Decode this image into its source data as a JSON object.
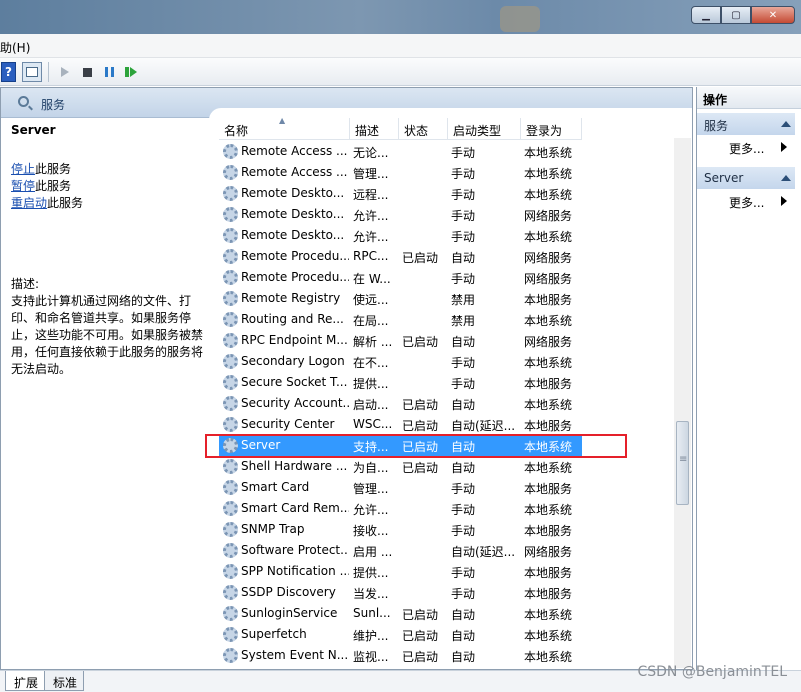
{
  "menubar": {
    "help": "助(H)"
  },
  "header": {
    "title": "服务"
  },
  "description": {
    "service_name": "Server",
    "actions": [
      {
        "link": "停止",
        "suffix": "此服务"
      },
      {
        "link": "暂停",
        "suffix": "此服务"
      },
      {
        "link": "重启动",
        "suffix": "此服务"
      }
    ],
    "label": "描述:",
    "text": "支持此计算机通过网络的文件、打印、和命名管道共享。如果服务停止，这些功能不可用。如果服务被禁用，任何直接依赖于此服务的服务将无法启动。"
  },
  "columns": {
    "name": "名称",
    "desc": "描述",
    "status": "状态",
    "startup": "启动类型",
    "logon": "登录为"
  },
  "rows": [
    {
      "name": "Remote Access ...",
      "desc": "无论...",
      "status": "",
      "startup": "手动",
      "logon": "本地系统"
    },
    {
      "name": "Remote Access ...",
      "desc": "管理...",
      "status": "",
      "startup": "手动",
      "logon": "本地系统"
    },
    {
      "name": "Remote Deskto...",
      "desc": "远程...",
      "status": "",
      "startup": "手动",
      "logon": "本地系统"
    },
    {
      "name": "Remote Deskto...",
      "desc": "允许...",
      "status": "",
      "startup": "手动",
      "logon": "网络服务"
    },
    {
      "name": "Remote Deskto...",
      "desc": "允许...",
      "status": "",
      "startup": "手动",
      "logon": "本地系统"
    },
    {
      "name": "Remote Procedu...",
      "desc": "RPC...",
      "status": "已启动",
      "startup": "自动",
      "logon": "网络服务"
    },
    {
      "name": "Remote Procedu...",
      "desc": "在 W...",
      "status": "",
      "startup": "手动",
      "logon": "网络服务"
    },
    {
      "name": "Remote Registry",
      "desc": "使远...",
      "status": "",
      "startup": "禁用",
      "logon": "本地服务"
    },
    {
      "name": "Routing and Re...",
      "desc": "在局...",
      "status": "",
      "startup": "禁用",
      "logon": "本地系统"
    },
    {
      "name": "RPC Endpoint M...",
      "desc": "解析 ...",
      "status": "已启动",
      "startup": "自动",
      "logon": "网络服务"
    },
    {
      "name": "Secondary Logon",
      "desc": "在不...",
      "status": "",
      "startup": "手动",
      "logon": "本地系统"
    },
    {
      "name": "Secure Socket T...",
      "desc": "提供...",
      "status": "",
      "startup": "手动",
      "logon": "本地服务"
    },
    {
      "name": "Security Account...",
      "desc": "启动...",
      "status": "已启动",
      "startup": "自动",
      "logon": "本地系统"
    },
    {
      "name": "Security Center",
      "desc": "WSC...",
      "status": "已启动",
      "startup": "自动(延迟...",
      "logon": "本地服务"
    },
    {
      "name": "Server",
      "desc": "支持...",
      "status": "已启动",
      "startup": "自动",
      "logon": "本地系统",
      "selected": true
    },
    {
      "name": "Shell Hardware ...",
      "desc": "为自...",
      "status": "已启动",
      "startup": "自动",
      "logon": "本地系统"
    },
    {
      "name": "Smart Card",
      "desc": "管理...",
      "status": "",
      "startup": "手动",
      "logon": "本地服务"
    },
    {
      "name": "Smart Card Rem...",
      "desc": "允许...",
      "status": "",
      "startup": "手动",
      "logon": "本地系统"
    },
    {
      "name": "SNMP Trap",
      "desc": "接收...",
      "status": "",
      "startup": "手动",
      "logon": "本地服务"
    },
    {
      "name": "Software Protect...",
      "desc": "启用 ...",
      "status": "",
      "startup": "自动(延迟...",
      "logon": "网络服务"
    },
    {
      "name": "SPP Notification ...",
      "desc": "提供...",
      "status": "",
      "startup": "手动",
      "logon": "本地服务"
    },
    {
      "name": "SSDP Discovery",
      "desc": "当发...",
      "status": "",
      "startup": "手动",
      "logon": "本地服务"
    },
    {
      "name": "SunloginService",
      "desc": "Sunl...",
      "status": "已启动",
      "startup": "自动",
      "logon": "本地系统"
    },
    {
      "name": "Superfetch",
      "desc": "维护...",
      "status": "已启动",
      "startup": "自动",
      "logon": "本地系统"
    },
    {
      "name": "System Event N...",
      "desc": "监视...",
      "status": "已启动",
      "startup": "自动",
      "logon": "本地系统"
    }
  ],
  "actions_pane": {
    "title": "操作",
    "sections": [
      {
        "label": "服务",
        "more": "更多..."
      },
      {
        "label": "Server",
        "more": "更多..."
      }
    ]
  },
  "tabs": {
    "extended": "扩展",
    "standard": "标准"
  },
  "watermark": "CSDN @BenjaminTEL"
}
